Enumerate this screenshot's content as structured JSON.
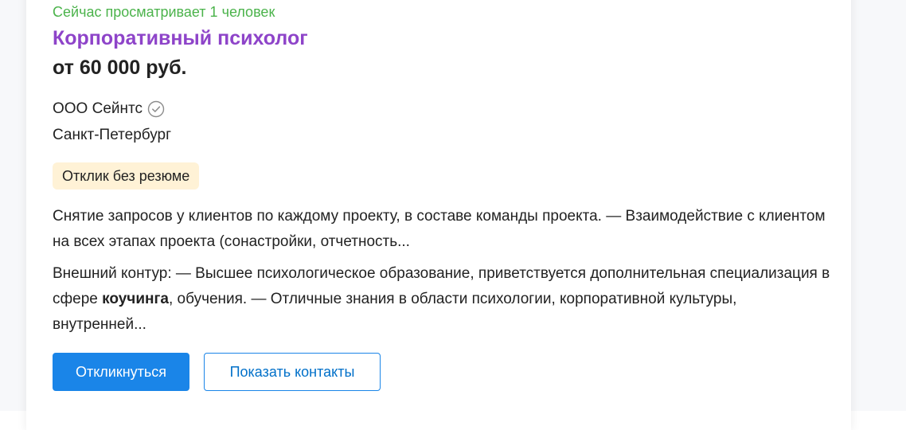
{
  "vacancy": {
    "viewers_text": "Сейчас просматривает 1 человек",
    "title": "Корпоративный психолог",
    "salary": "от 60 000 руб.",
    "company": "ООО Сейнтс",
    "company_verified_icon": "check-circle-icon",
    "city": "Санкт-Петербург",
    "badge": "Отклик без резюме",
    "description_1": "Снятие запросов у клиентов по каждому проекту, в составе команды проекта. — Взаимодействие с клиентом на всех этапах проекта (сонастройки, отчетность...",
    "description_2_before": "Внешний контур: — Высшее психологическое образование, приветствуется дополнительная специализация в сфере ",
    "description_2_highlight": "коучинга",
    "description_2_after": ", обучения. — Отличные знания в области психологии, корпоративной культуры, внутренней..."
  },
  "actions": {
    "respond_label": "Откликнуться",
    "show_contacts_label": "Показать контакты"
  },
  "colors": {
    "title": "#8e44c9",
    "viewers": "#4bb34b",
    "badge_bg": "#fff2d6",
    "primary_button": "#1a85e8"
  }
}
